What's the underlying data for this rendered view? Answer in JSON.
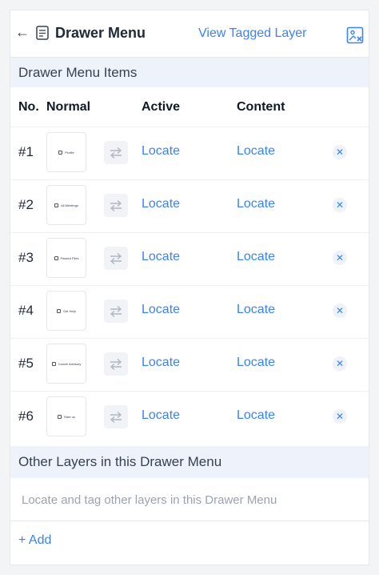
{
  "header": {
    "back_icon": "arrow-left-icon",
    "menu_icon": "document-icon",
    "title": "Drawer Menu",
    "view_tagged_label": "View Tagged Layer",
    "untag_icon": "image-remove-icon"
  },
  "items_section": {
    "title": "Drawer Menu Items"
  },
  "columns": {
    "no": "No.",
    "normal": "Normal",
    "active": "Active",
    "content": "Content"
  },
  "rows": [
    {
      "num": "#1",
      "thumb_label": "Profile",
      "active": "Locate",
      "content": "Locate"
    },
    {
      "num": "#2",
      "thumb_label": "All Meetings",
      "active": "Locate",
      "content": "Locate"
    },
    {
      "num": "#3",
      "thumb_label": "Passed Files",
      "active": "Locate",
      "content": "Locate"
    },
    {
      "num": "#4",
      "thumb_label": "Get Help",
      "active": "Locate",
      "content": "Locate"
    },
    {
      "num": "#5",
      "thumb_label": "Cancel Advisory",
      "active": "Locate",
      "content": "Locate"
    },
    {
      "num": "#6",
      "thumb_label": "Rate us",
      "active": "Locate",
      "content": "Locate"
    }
  ],
  "other_section": {
    "title": "Other Layers in this Drawer Menu",
    "placeholder": "Locate and tag other layers in this Drawer Menu",
    "add_label": "+ Add"
  },
  "colors": {
    "accent": "#3b82f6",
    "section_bg": "#eef3fb",
    "text": "#1f2937"
  }
}
